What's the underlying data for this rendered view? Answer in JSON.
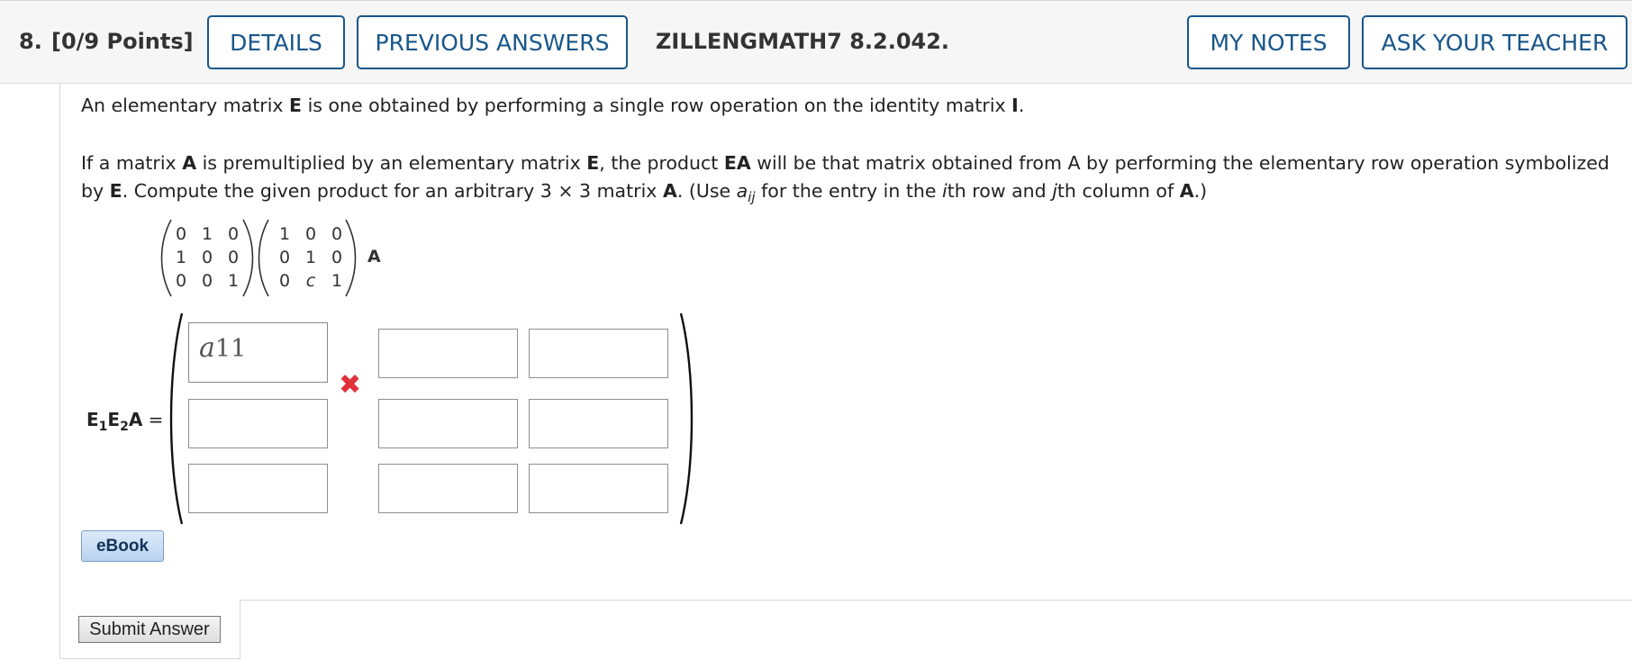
{
  "header": {
    "question_number": "8.",
    "points": "[0/9 Points]",
    "details_label": "DETAILS",
    "previous_answers_label": "PREVIOUS ANSWERS",
    "question_id": "ZILLENGMATH7 8.2.042.",
    "my_notes_label": "MY NOTES",
    "ask_teacher_label": "ASK YOUR TEACHER"
  },
  "problem": {
    "line1": {
      "a": "An elementary matrix ",
      "b": "E",
      "c": " is one obtained by performing a single row operation on the identity matrix ",
      "d": "I",
      "e": "."
    },
    "line2": {
      "a": "If a matrix ",
      "b": "A",
      "c": " is premultiplied by an elementary matrix ",
      "d": "E",
      "e": ", the product ",
      "f": "EA",
      "g": " will be that matrix obtained from A by performing the elementary row operation symbolized"
    },
    "line3": {
      "a": "by ",
      "b": "E",
      "c": ". Compute the given product for an arbitrary  3 × 3  matrix ",
      "d": "A",
      "e": ". (Use  ",
      "f": "a",
      "g": "ij",
      "h": "  for the entry in the ",
      "i": "i",
      "j": "th row and ",
      "k": "j",
      "l": "th column of ",
      "m": "A",
      "n": ".)"
    }
  },
  "matrix_e1": [
    [
      "0",
      "1",
      "0"
    ],
    [
      "1",
      "0",
      "0"
    ],
    [
      "0",
      "0",
      "1"
    ]
  ],
  "matrix_e2": [
    [
      "1",
      "0",
      "0"
    ],
    [
      "0",
      "1",
      "0"
    ],
    [
      "0",
      "c",
      "1"
    ]
  ],
  "matrix_a_label": "A",
  "product_label": {
    "e1": "E",
    "sub1": "1",
    "e2": "E",
    "sub2": "2",
    "a": "A",
    "eq": " ="
  },
  "answer": {
    "r1c1": "a11",
    "r1c1_status": "incorrect"
  },
  "icons": {
    "wrong": "x-mark-icon"
  },
  "colors": {
    "accent": "#18568a",
    "wrong": "#e0303a"
  },
  "ebook_label": "eBook",
  "submit_label": "Submit Answer"
}
